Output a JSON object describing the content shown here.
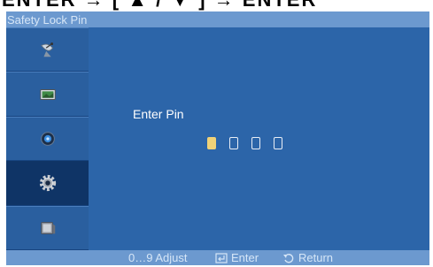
{
  "banner": {
    "text": "ENTER → [ ▲ / ▼ ] → ENTER"
  },
  "window": {
    "title": "Safety Lock Pin"
  },
  "sidebar": {
    "items": [
      {
        "icon": "satellite-dish-icon"
      },
      {
        "icon": "picture-icon"
      },
      {
        "icon": "sound-icon"
      },
      {
        "icon": "setup-gear-icon",
        "active": true
      },
      {
        "icon": "multi-control-icon"
      }
    ]
  },
  "main": {
    "prompt": "Enter  Pin",
    "pin_boxes": 4,
    "active_box": 1
  },
  "footer": {
    "adjust": "0…9 Adjust",
    "enter": "Enter",
    "return": "Return"
  },
  "colors": {
    "panel": "#2c65a9",
    "bar": "#6c99cf",
    "active_item": "#0f3466",
    "cursor": "#f0d278"
  }
}
